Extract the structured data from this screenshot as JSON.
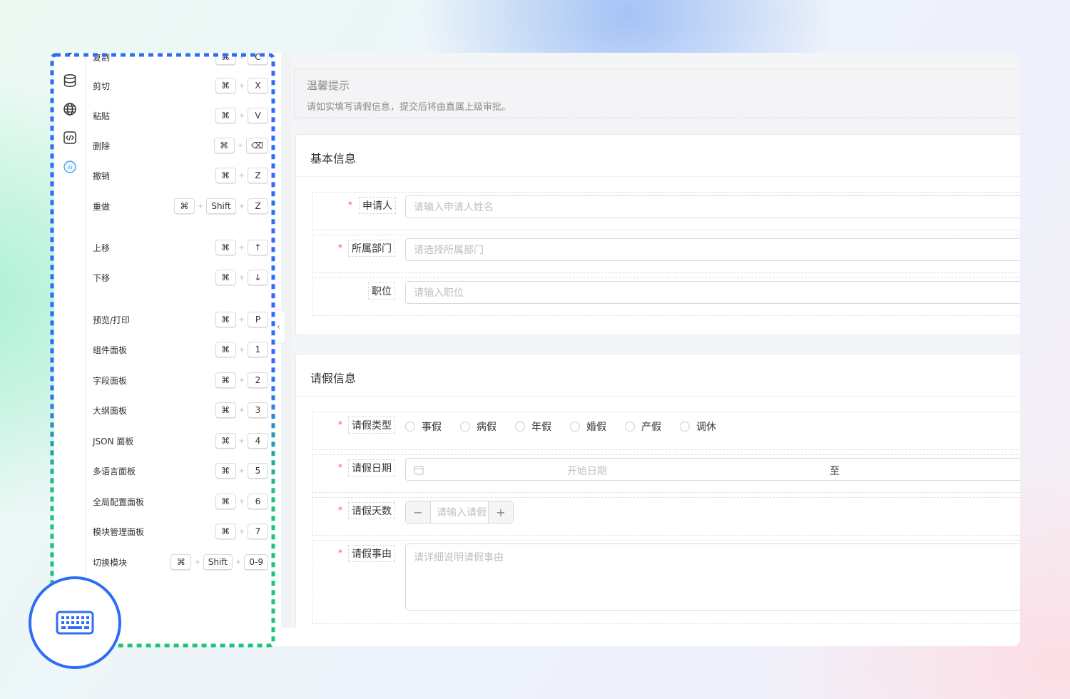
{
  "rail": {
    "icons": [
      "database-icon",
      "globe-icon",
      "code-icon",
      "ai-icon"
    ],
    "ai_label": "AI"
  },
  "shortcuts": [
    {
      "label": "复制",
      "keys": [
        "⌘",
        "C"
      ]
    },
    {
      "label": "剪切",
      "keys": [
        "⌘",
        "X"
      ]
    },
    {
      "label": "粘贴",
      "keys": [
        "⌘",
        "V"
      ]
    },
    {
      "label": "删除",
      "keys": [
        "⌘",
        "⌫"
      ]
    },
    {
      "label": "撤销",
      "keys": [
        "⌘",
        "Z"
      ]
    },
    {
      "label": "重做",
      "keys": [
        "⌘",
        "Shift",
        "Z"
      ]
    },
    {
      "label": "上移",
      "keys": [
        "⌘",
        "↑"
      ]
    },
    {
      "label": "下移",
      "keys": [
        "⌘",
        "↓"
      ]
    },
    {
      "label": "预览/打印",
      "keys": [
        "⌘",
        "P"
      ]
    },
    {
      "label": "组件面板",
      "keys": [
        "⌘",
        "1"
      ]
    },
    {
      "label": "字段面板",
      "keys": [
        "⌘",
        "2"
      ]
    },
    {
      "label": "大纲面板",
      "keys": [
        "⌘",
        "3"
      ]
    },
    {
      "label": "JSON 面板",
      "keys": [
        "⌘",
        "4"
      ]
    },
    {
      "label": "多语言面板",
      "keys": [
        "⌘",
        "5"
      ]
    },
    {
      "label": "全局配置面板",
      "keys": [
        "⌘",
        "6"
      ]
    },
    {
      "label": "模块管理面板",
      "keys": [
        "⌘",
        "7"
      ]
    },
    {
      "label": "切换模块",
      "keys": [
        "⌘",
        "Shift",
        "0-9"
      ]
    }
  ],
  "collapse_glyph": "‹",
  "notice": {
    "title": "温馨提示",
    "desc": "请如实填写请假信息，提交后将由直属上级审批。"
  },
  "basic": {
    "title": "基本信息",
    "fields": [
      {
        "label": "申请人",
        "required": true,
        "placeholder": "请输入申请人姓名"
      },
      {
        "label": "所属部门",
        "required": true,
        "placeholder": "请选择所属部门"
      },
      {
        "label": "职位",
        "required": false,
        "placeholder": "请输入职位"
      }
    ]
  },
  "leave": {
    "title": "请假信息",
    "type": {
      "label": "请假类型",
      "options": [
        "事假",
        "病假",
        "年假",
        "婚假",
        "产假",
        "调休"
      ]
    },
    "date": {
      "label": "请假日期",
      "start_placeholder": "开始日期",
      "separator": "至"
    },
    "days": {
      "label": "请假天数",
      "placeholder": "请输入请假",
      "minus": "−",
      "plus": "+"
    },
    "reason": {
      "label": "请假事由",
      "placeholder": "请详细说明请假事由"
    }
  },
  "colors": {
    "highlight_blue": "#2f6df6",
    "highlight_green": "#1ec47a",
    "required_red": "#ff4d4f"
  }
}
